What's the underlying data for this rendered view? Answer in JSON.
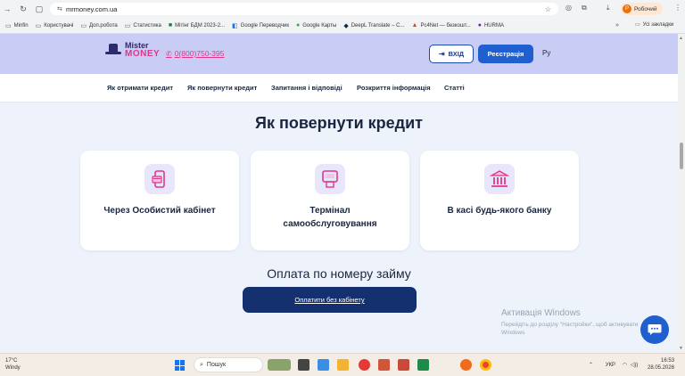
{
  "browser": {
    "url": "mrmoney.com.ua",
    "profile_initial": "Р",
    "profile_label": "Робочий",
    "bookmarks": [
      "Minfin",
      "Користувачі",
      "Доп.робота",
      "Статистика",
      "Мітінг БДМ 2023-2...",
      "Google Переводчик",
      "Google Карты",
      "DeepL Translate – С...",
      "Рс4Net — безкошт...",
      "HURMA"
    ],
    "all_bookmarks": "Усі закладки",
    "more": "»"
  },
  "header": {
    "logo_line1": "Mister",
    "logo_line2": "MONEY",
    "phone": "0(800)750-395",
    "login_label": "ВХІД",
    "register_label": "Реєстрація",
    "language": "Ру"
  },
  "menu": {
    "items": [
      "Як отримати кредит",
      "Як повернути кредит",
      "Запитання і відповіді",
      "Розкриття інформація",
      "Статті"
    ]
  },
  "main": {
    "title": "Як повернути кредит",
    "cards": [
      {
        "label": "Через Особистий кабінет",
        "icon": "phone-card-icon"
      },
      {
        "label_line1": "Термінал",
        "label_line2": "самообслуговування",
        "icon": "terminal-icon"
      },
      {
        "label": "В касі будь-якого банку",
        "icon": "bank-icon"
      }
    ],
    "pay_title": "Оплата по номеру займу",
    "pay_button": "Оплатити без кабінету"
  },
  "overlay": {
    "activation_title": "Активація Windows",
    "activation_text": "Перейдіть до розділу \"Настройки\", щоб активувати Windows"
  },
  "taskbar": {
    "temp": "17°C",
    "weather": "Windy",
    "search_placeholder": "Пошук",
    "lang": "УКР",
    "time": "16:53",
    "date": "28.05.2026"
  },
  "colors": {
    "header_bg": "#c9ccf5",
    "accent_pink": "#e0378a",
    "primary_blue": "#1f5fd0",
    "dark_navy": "#14306f",
    "page_bg": "#eef3fb"
  }
}
